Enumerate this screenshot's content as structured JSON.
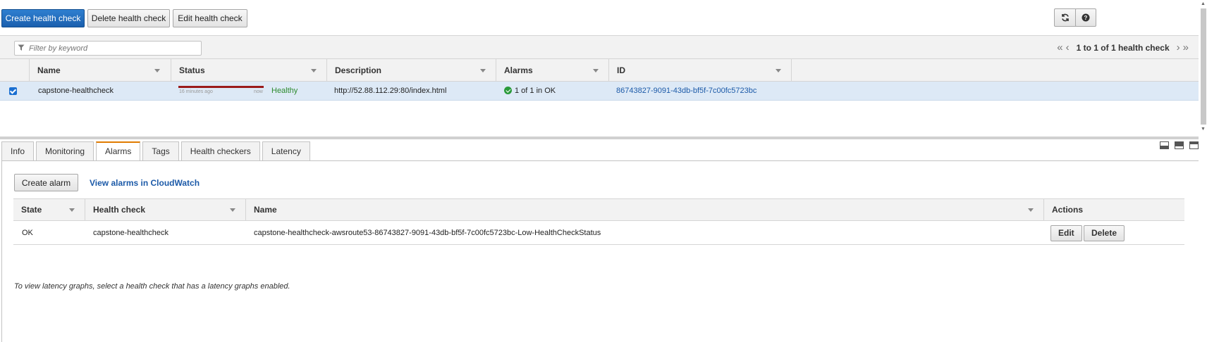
{
  "toolbar": {
    "create_label": "Create health check",
    "delete_label": "Delete health check",
    "edit_label": "Edit health check",
    "refresh_icon": "refresh-icon",
    "help_icon": "help-icon"
  },
  "filter": {
    "placeholder": "Filter by keyword"
  },
  "pager": {
    "text": "1 to 1 of 1 health check"
  },
  "table": {
    "columns": [
      "Name",
      "Status",
      "Description",
      "Alarms",
      "ID"
    ],
    "rows": [
      {
        "name": "capstone-healthcheck",
        "status_left": "16 minutes ago",
        "status_right": "now",
        "status": "Healthy",
        "description": "http://52.88.112.29:80/index.html",
        "alarms": "1 of 1 in OK",
        "id": "86743827-9091-43db-bf5f-7c00fc5723bc"
      }
    ]
  },
  "tabs": [
    "Info",
    "Monitoring",
    "Alarms",
    "Tags",
    "Health checkers",
    "Latency"
  ],
  "active_tab": "Alarms",
  "alarms_panel": {
    "create_alarm_label": "Create alarm",
    "view_cloudwatch_label": "View alarms in CloudWatch",
    "columns": [
      "State",
      "Health check",
      "Name",
      "Actions"
    ],
    "rows": [
      {
        "state": "OK",
        "health_check": "capstone-healthcheck",
        "name": "capstone-healthcheck-awsroute53-86743827-9091-43db-bf5f-7c00fc5723bc-Low-HealthCheckStatus",
        "edit_label": "Edit",
        "delete_label": "Delete"
      }
    ],
    "latency_note": "To view latency graphs, select a health check that has a latency graphs enabled."
  },
  "colors": {
    "primary": "#1a5fae",
    "healthy": "#2d8a2d",
    "link": "#1c5aa8",
    "active_tab_accent": "#e07b00",
    "status_bar": "#9a1b1b"
  }
}
